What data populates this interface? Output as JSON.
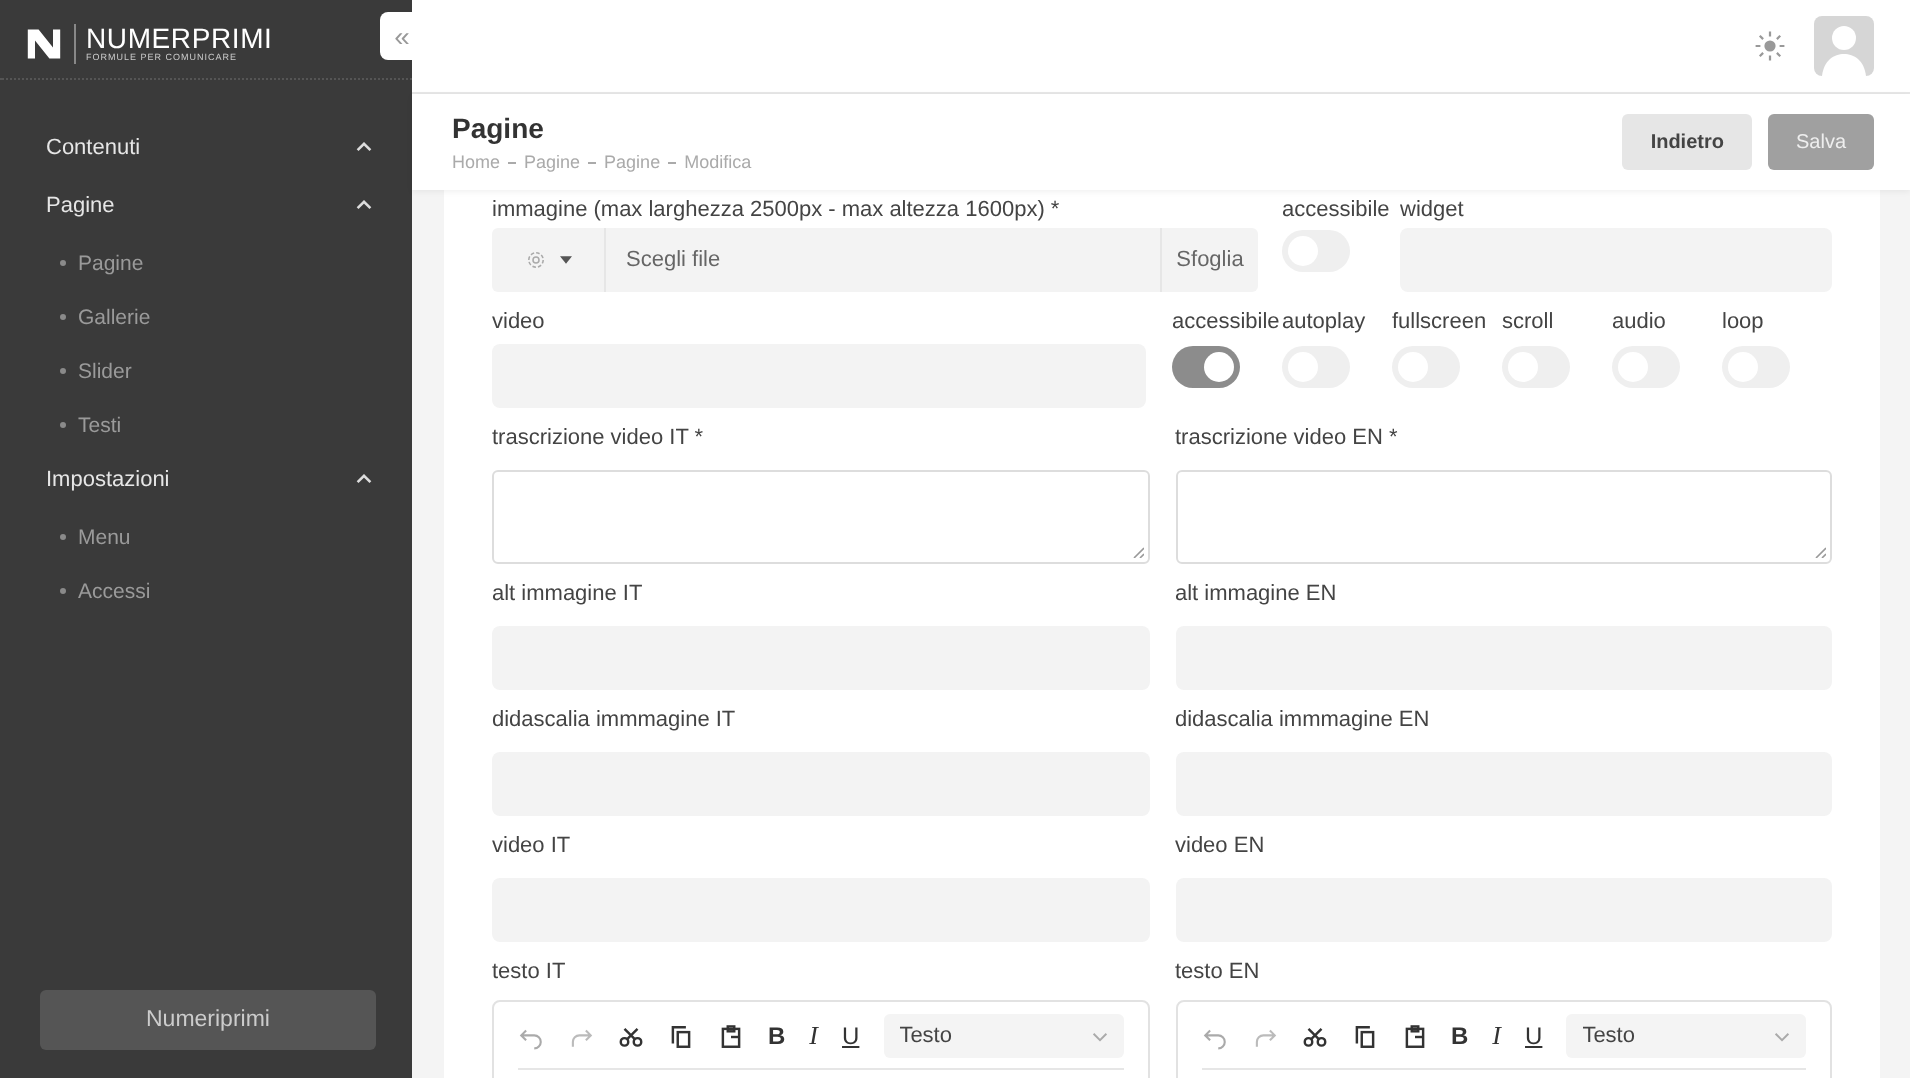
{
  "brand": {
    "name": "NUMERPRIMI",
    "tagline": "FORMULE PER COMUNICARE"
  },
  "collapse_button": "«",
  "sidebar": {
    "sections": [
      {
        "label": "Contenuti",
        "expanded": true
      },
      {
        "label": "Pagine",
        "expanded": true,
        "children": [
          {
            "label": "Pagine"
          },
          {
            "label": "Gallerie"
          },
          {
            "label": "Slider"
          },
          {
            "label": "Testi"
          }
        ]
      },
      {
        "label": "Impostazioni",
        "expanded": true,
        "children": [
          {
            "label": "Menu"
          },
          {
            "label": "Accessi"
          }
        ]
      }
    ],
    "footer_button": "Numeriprimi"
  },
  "page": {
    "title": "Pagine",
    "breadcrumb": [
      "Home",
      "Pagine",
      "Pagine",
      "Modifica"
    ],
    "buttons": [
      {
        "label": "Indietro",
        "kind": "secondary"
      },
      {
        "label": "Salva",
        "kind": "primary"
      }
    ]
  },
  "form": [
    {
      "kind": "media",
      "file": {
        "label": "immagine (max larghezza 2500px - max altezza 1600px) *",
        "placeholder": "Scegli file",
        "button": "Sfoglia"
      },
      "toggle": {
        "label": "accessibile",
        "on": false
      },
      "widget": {
        "label": "widget"
      }
    },
    {
      "kind": "video",
      "field": {
        "label": "video"
      },
      "toggles": [
        {
          "label": "accessibile",
          "on": true
        },
        {
          "label": "autoplay",
          "on": false
        },
        {
          "label": "fullscreen",
          "on": false
        },
        {
          "label": "scroll",
          "on": false
        },
        {
          "label": "audio",
          "on": false
        },
        {
          "label": "loop",
          "on": false
        }
      ]
    },
    {
      "kind": "textarea",
      "fields": [
        {
          "label": "trascrizione video IT *"
        },
        {
          "label": "trascrizione video EN *"
        }
      ]
    },
    {
      "kind": "text",
      "fields": [
        {
          "label": "alt immagine IT"
        },
        {
          "label": "alt immagine EN"
        }
      ]
    },
    {
      "kind": "text",
      "fields": [
        {
          "label": "didascalia immmagine IT"
        },
        {
          "label": "didascalia immmagine EN"
        }
      ]
    },
    {
      "kind": "text",
      "fields": [
        {
          "label": "video IT"
        },
        {
          "label": "video EN"
        }
      ]
    },
    {
      "kind": "editor",
      "fields": [
        {
          "label": "testo IT",
          "format": [
            "B",
            "I",
            "U"
          ],
          "style": "Testo"
        },
        {
          "label": "testo EN",
          "format": [
            "B",
            "I",
            "U"
          ],
          "style": "Testo"
        }
      ]
    }
  ]
}
